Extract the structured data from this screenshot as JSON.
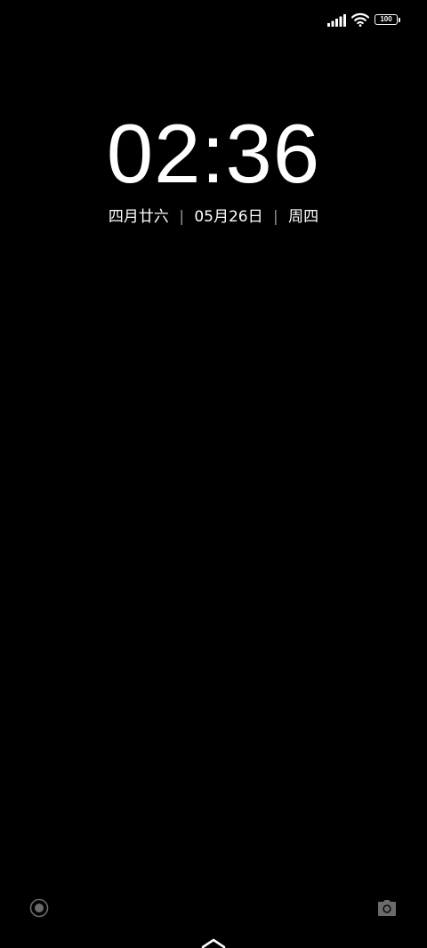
{
  "status_bar": {
    "signal_icon": "signal-bars-icon",
    "wifi_icon": "wifi-icon",
    "battery_level": "100",
    "battery_percent": 100
  },
  "lockscreen": {
    "time": "02:36",
    "lunar_date": "四月廿六",
    "separator": "|",
    "date": "05月26日",
    "weekday": "周四"
  },
  "shortcuts": {
    "left_icon": "control-center-icon",
    "right_icon": "camera-icon",
    "unlock_indicator": "chevron-up-icon"
  },
  "colors": {
    "background": "#000000",
    "foreground": "#ffffff",
    "shortcut_icon": "#6b6b6b"
  }
}
